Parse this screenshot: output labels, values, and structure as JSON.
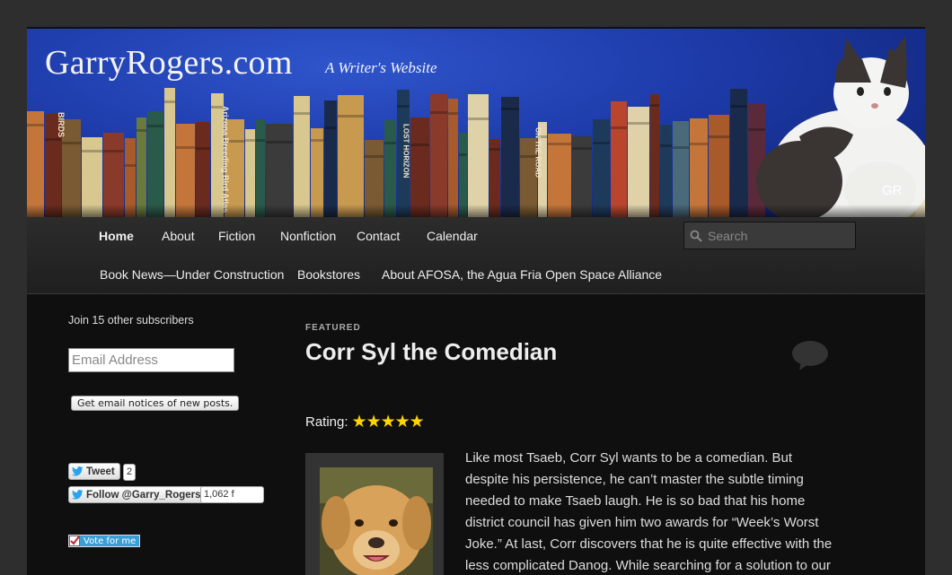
{
  "header": {
    "site_title": "GarryRogers.com",
    "tagline": "A Writer's Website",
    "mark": "GR"
  },
  "nav": {
    "row1": [
      {
        "label": "Home",
        "active": true
      },
      {
        "label": "About"
      },
      {
        "label": "Fiction"
      },
      {
        "label": "Nonfiction"
      },
      {
        "label": "Contact"
      },
      {
        "label": "Calendar"
      }
    ],
    "row2": [
      {
        "label": "Book News—Under Construction"
      },
      {
        "label": "Bookstores"
      },
      {
        "label": "About AFOSA, the Agua Fria Open Space Alliance"
      }
    ],
    "search_placeholder": "Search"
  },
  "sidebar": {
    "subscribers_text": "Join 15 other subscribers",
    "email_placeholder": "Email Address",
    "subscribe_button": "Get email notices of new posts.",
    "tweet_label": "Tweet",
    "tweet_count": "2",
    "follow_label": "Follow @Garry_Rogers",
    "follow_count": "1,062 f",
    "vote_label": "Vote for me"
  },
  "post": {
    "featured_label": "FEATURED",
    "title": "Corr Syl the Comedian",
    "rating_label": "Rating:",
    "rating_stars": 5,
    "body": "Like most Tsaeb, Corr Syl wants to be a comedian.  But despite his persistence, he can’t master the subtle timing needed to make Tsaeb laugh.  He is so bad that his home district council has given him two awards for “Week’s Worst Joke.”  At last, Corr discovers that he is quite effective with the less complicated Danog.  While searching for a solution to our"
  },
  "book_spines": {
    "birds": "BIRDS",
    "arizona": "Arizona Breeding Bird Atlas",
    "horizon": "LOST HORIZON",
    "road": "ON THE ROAD"
  }
}
